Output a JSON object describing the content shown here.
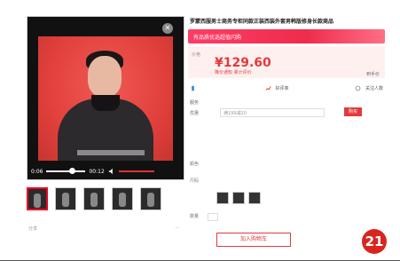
{
  "product": {
    "title": "罗蒙西服男士商务专柜同款正装西装外套男韩版修身长款商品",
    "promo_banner": "有品质优选超值闪购",
    "price_label": "价格",
    "price": "¥129.60",
    "price_note": "降价通知 累计评价",
    "price_right": "到手价"
  },
  "video": {
    "current_time": "0:06",
    "duration": "00:12"
  },
  "stats": {
    "rating_label": "好评率",
    "favorites_label": "关注人数",
    "share_label": "分享"
  },
  "purchase": {
    "coupon_label": "优惠",
    "coupon_value": "满199减20",
    "buy_button": "购买",
    "service_label": "服务",
    "cart_button": "加入购物车"
  },
  "options": {
    "color_label": "颜色",
    "size_label": "尺码",
    "quantity_label": "数量"
  },
  "thumbnails": [
    "缩略图1",
    "缩略图2",
    "缩略图3",
    "缩略图4",
    "缩略图5"
  ],
  "badge": "21",
  "colors": {
    "accent": "#e4393c",
    "banner_start": "#ff3c66",
    "video_bg": "#e2403c",
    "badge": "#d8261f"
  }
}
